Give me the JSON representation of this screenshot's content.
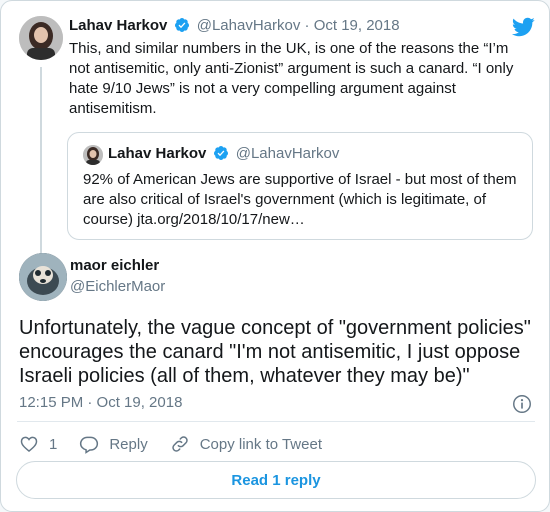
{
  "brand_icon": "twitter-bird-icon",
  "colors": {
    "accent": "#1da1f2",
    "link": "#1b95e0",
    "muted": "#657786",
    "border": "#cfd9de"
  },
  "parent_tweet": {
    "name": "Lahav Harkov",
    "handle": "@LahavHarkov",
    "separator": "·",
    "date": "Oct 19, 2018",
    "text": "This, and similar numbers in the UK, is one of the reasons the “I’m not antisemitic, only anti-Zionist” argument is such a canard. “I only hate 9/10 Jews” is not a very compelling argument against antisemitism."
  },
  "quoted_tweet": {
    "name": "Lahav Harkov",
    "handle": "@LahavHarkov",
    "text": "92% of American Jews are supportive of Israel - but most of them are also critical of Israel's government (which is legitimate, of course) jta.org/2018/10/17/new…"
  },
  "main_tweet": {
    "name": "maor eichler",
    "handle": "@EichlerMaor",
    "text": "Unfortunately, the vague concept of \"government policies\" encourages the canard \"I'm not antisemitic, I just oppose Israeli policies (all of them, whatever they may be)\"",
    "timestamp": "12:15 PM · Oct 19, 2018"
  },
  "actions": {
    "like_count": "1",
    "reply_label": "Reply",
    "copy_link_label": "Copy link to Tweet"
  },
  "read_replies_label": "Read 1 reply"
}
